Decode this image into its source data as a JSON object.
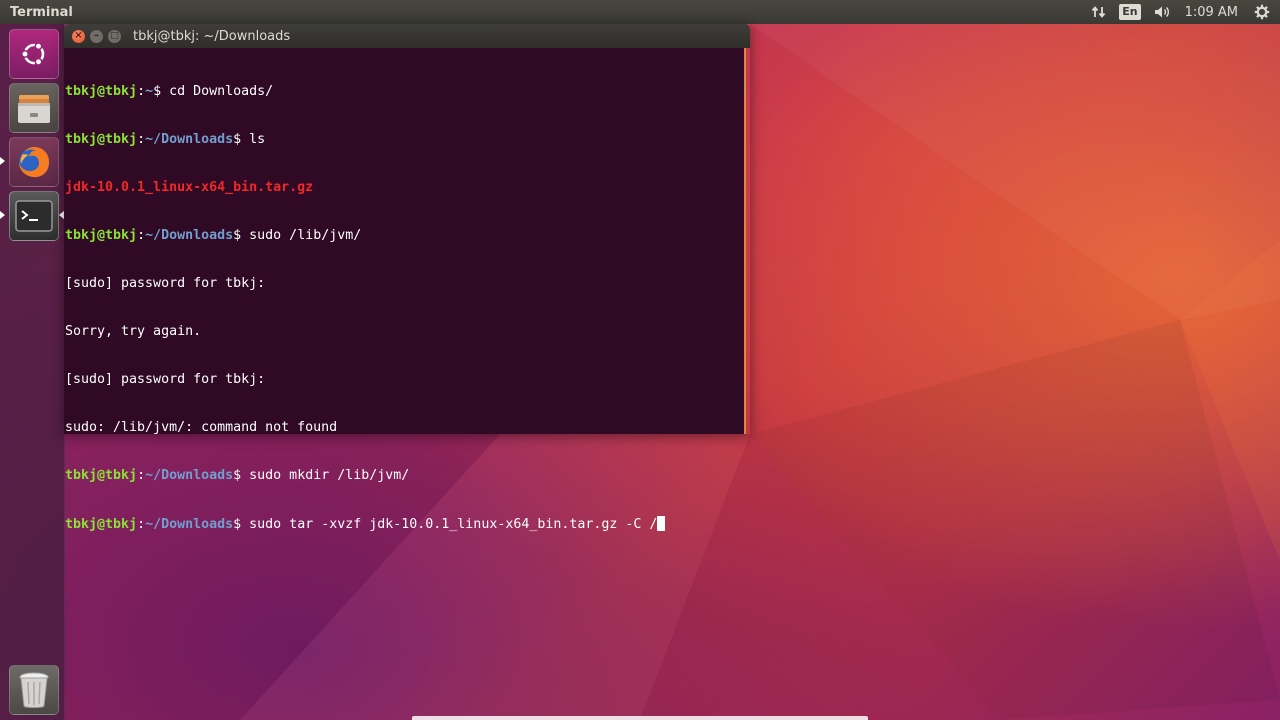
{
  "top_panel": {
    "app_title": "Terminal",
    "keyboard_layout": "En",
    "clock": "1:09 AM",
    "icons": [
      "network-transfer-icon",
      "keyboard-layout-indicator",
      "volume-icon",
      "gear-icon"
    ]
  },
  "launcher": {
    "items": [
      {
        "name": "dash-home-button",
        "icon": "ubuntu-logo-icon"
      },
      {
        "name": "files-launcher-button",
        "icon": "file-cabinet-icon"
      },
      {
        "name": "firefox-launcher-button",
        "icon": "firefox-icon"
      },
      {
        "name": "terminal-launcher-button",
        "icon": "terminal-icon",
        "active": true
      },
      {
        "name": "trash-launcher-button",
        "icon": "trash-icon"
      }
    ]
  },
  "window": {
    "title": "tbkj@tbkj: ~/Downloads",
    "close_glyph": "×",
    "min_glyph": "–",
    "max_glyph": "□"
  },
  "terminal": {
    "lines": [
      {
        "user": "tbkj@tbkj",
        "sep": ":",
        "path": "~",
        "sigil": "$ ",
        "cmd": "cd Downloads/"
      },
      {
        "user": "tbkj@tbkj",
        "sep": ":",
        "path": "~/Downloads",
        "sigil": "$ ",
        "cmd": "ls"
      },
      {
        "file": "jdk-10.0.1_linux-x64_bin.tar.gz"
      },
      {
        "user": "tbkj@tbkj",
        "sep": ":",
        "path": "~/Downloads",
        "sigil": "$ ",
        "cmd": "sudo /lib/jvm/"
      },
      {
        "out": "[sudo] password for tbkj:"
      },
      {
        "out": "Sorry, try again."
      },
      {
        "out": "[sudo] password for tbkj:"
      },
      {
        "out": "sudo: /lib/jvm/: command not found"
      },
      {
        "user": "tbkj@tbkj",
        "sep": ":",
        "path": "~/Downloads",
        "sigil": "$ ",
        "cmd": "sudo mkdir /lib/jvm/"
      },
      {
        "user": "tbkj@tbkj",
        "sep": ":",
        "path": "~/Downloads",
        "sigil": "$ ",
        "cmd": "sudo tar -xvzf jdk-10.0.1_linux-x64_bin.tar.gz -C /"
      }
    ]
  },
  "colors": {
    "terminal_bg": "#300a24",
    "prompt_user": "#8ae234",
    "prompt_path": "#729fcf",
    "archive_file": "#ef2929",
    "window_accent": "#e0863e"
  }
}
